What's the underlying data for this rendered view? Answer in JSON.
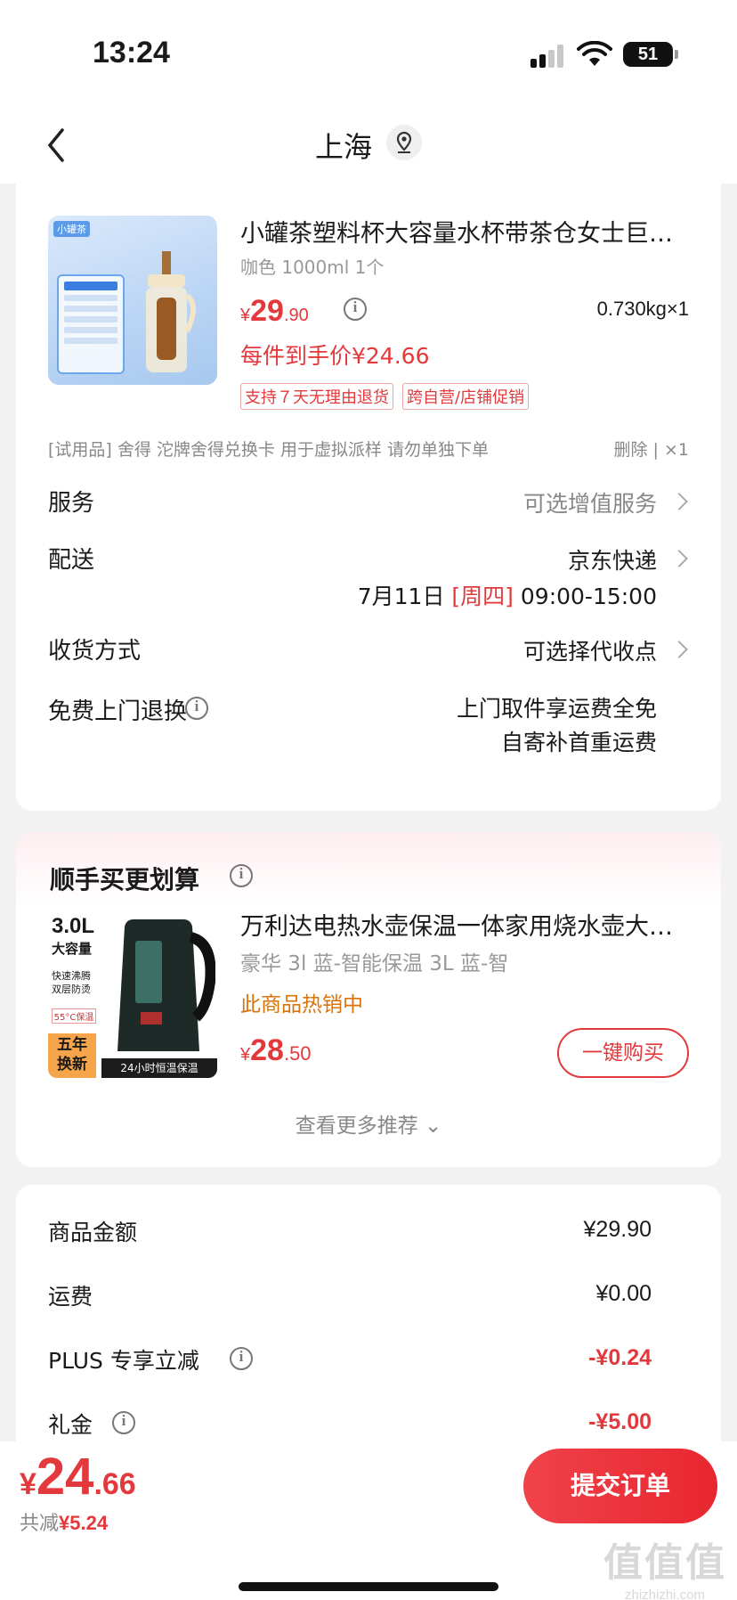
{
  "status_bar": {
    "time": "13:24",
    "battery": "51"
  },
  "nav": {
    "title": "上海"
  },
  "product": {
    "title": "小罐茶塑料杯大容量水杯带茶仓女士巨无霸泡茶杯",
    "spec": "咖色 1000ml 1个",
    "price_symbol": "¥",
    "price_int": "29",
    "price_dec": ".90",
    "weight": "0.730kg×1",
    "hand_price": "每件到手价¥24.66",
    "badges": [
      "支持７天无理由退货",
      "跨自营/店铺促销"
    ],
    "image_tag": "小罐茶"
  },
  "trial": {
    "text": "[试用品] 舍得 沱牌舍得兑换卡 用于虚拟派样 请勿单独下单",
    "action": "删除 | ×1"
  },
  "service": {
    "label": "服务",
    "value": "可选增值服务"
  },
  "delivery": {
    "label": "配送",
    "carrier": "京东快递",
    "date": "7月11日 ",
    "weekday": "[周四]",
    "time": " 09:00-15:00"
  },
  "receive": {
    "label": "收货方式",
    "value": "可选择代收点"
  },
  "free_return": {
    "label": "免费上门退换",
    "line1": "上门取件享运费全免",
    "line2": "自寄补首重运费"
  },
  "recommend": {
    "title": "顺手买更划算",
    "item_title": "万利达电热水壶保温一体家用烧水壶大容量",
    "spec": "豪华 3l 蓝-智能保温 3L 蓝-智",
    "hot": "此商品热销中",
    "price_symbol": "¥",
    "price_int": "28",
    "price_dec": ".50",
    "buy_label": "一键购买",
    "more": "查看更多推荐 ⌄",
    "image_texts": {
      "capacity": "3.0L",
      "big": "大容量",
      "features": "快速沸腾\n双层防烫",
      "keep": "55°C保温",
      "guarantee": "五年\n换新",
      "band": "24小时恒温保温"
    }
  },
  "amounts": [
    {
      "label": "商品金额",
      "value": "¥29.90",
      "neg": false,
      "info": false
    },
    {
      "label": "运费",
      "value": "¥0.00",
      "neg": false,
      "info": false
    },
    {
      "label": "PLUS 专享立减",
      "value": "-¥0.24",
      "neg": true,
      "info": true
    },
    {
      "label": "礼金",
      "value": "-¥5.00",
      "neg": true,
      "info": true
    }
  ],
  "bottom": {
    "symbol": "¥",
    "total_int": "24",
    "total_dec": ".66",
    "saved_label": "共减",
    "saved_value": "¥5.24",
    "submit": "提交订单"
  },
  "watermark": {
    "big": "值值值",
    "small": "zhizhizhi.com"
  },
  "colors": {
    "accent": "#e4393c",
    "hot": "#d9730a"
  }
}
